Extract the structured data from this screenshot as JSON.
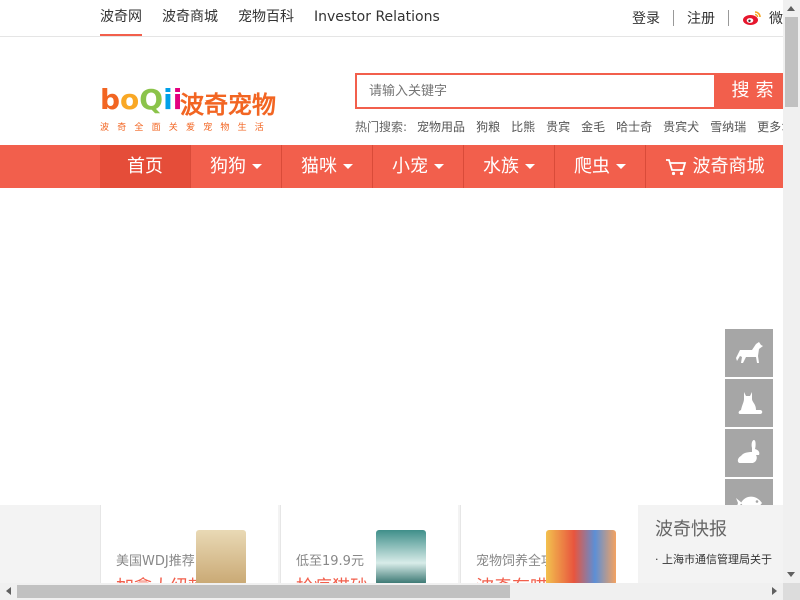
{
  "topbar": {
    "links": [
      "波奇网",
      "波奇商城",
      "宠物百科",
      "Investor Relations"
    ],
    "login": "登录",
    "register": "注册",
    "weibo": "微"
  },
  "logo": {
    "letters": [
      "b",
      "o",
      "Q",
      "i",
      "i"
    ],
    "colors": [
      "#f26522",
      "#f9a825",
      "#8bc34a",
      "#00a0e9",
      "#e4007f"
    ],
    "cn": "波奇宠物",
    "slogan": "波奇全面关爱宠物生活"
  },
  "search": {
    "placeholder": "请输入关键字",
    "button": "搜索",
    "hot_label": "热门搜索:",
    "hot_items": [
      "宠物用品",
      "狗粮",
      "比熊",
      "贵宾",
      "金毛",
      "哈士奇",
      "贵宾犬",
      "雪纳瑞",
      "更多>"
    ]
  },
  "nav": {
    "home": "首页",
    "dropdowns": [
      "狗狗",
      "猫咪",
      "小宠",
      "水族",
      "爬虫"
    ],
    "shop": "波奇商城"
  },
  "pet_sidebar": [
    "dog-icon",
    "cat-icon",
    "rabbit-icon",
    "fish-icon",
    "lizard-icon"
  ],
  "promo": {
    "cards": [
      {
        "sub": "美国WDJ推荐",
        "title": "加拿大纽顿"
      },
      {
        "sub": "低至19.9元",
        "title": "抢疯猫砂"
      },
      {
        "sub": "宠物饲养全攻略",
        "title": "波奇有喵"
      }
    ],
    "news_title": "波奇快报",
    "news_item": "· 上海市通信管理局关于"
  },
  "colors": {
    "brand": "#f25f4c",
    "brand_dark": "#e54d39",
    "sidebar_gray": "#a6a6a6"
  }
}
